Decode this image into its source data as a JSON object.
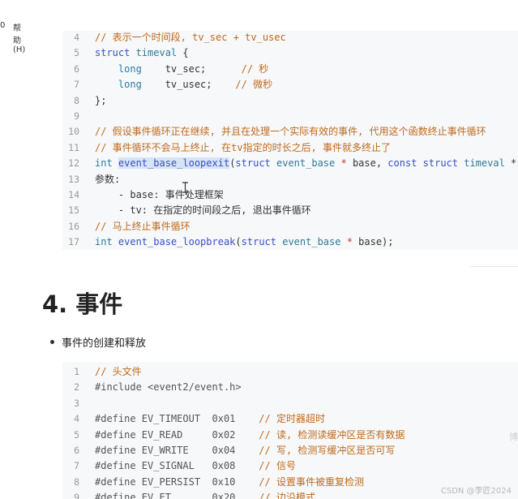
{
  "menu": {
    "left_fragment": "0",
    "help_label": "帮助(H)"
  },
  "code_block_1": {
    "lines": [
      {
        "n": "4",
        "parts": [
          {
            "t": "// 表示一个时间段, tv_sec + tv_usec",
            "c": "cm"
          }
        ]
      },
      {
        "n": "5",
        "parts": [
          {
            "t": "struct ",
            "c": "kw"
          },
          {
            "t": "timeval",
            "c": "ty"
          },
          {
            "t": " {",
            "c": "pl"
          }
        ]
      },
      {
        "n": "6",
        "parts": [
          {
            "t": "    long",
            "c": "ty"
          },
          {
            "t": "    tv_sec;      ",
            "c": "pl"
          },
          {
            "t": "// 秒",
            "c": "cm"
          }
        ]
      },
      {
        "n": "7",
        "parts": [
          {
            "t": "    long",
            "c": "ty"
          },
          {
            "t": "    tv_usec;    ",
            "c": "pl"
          },
          {
            "t": "// 微秒",
            "c": "cm"
          }
        ]
      },
      {
        "n": "8",
        "parts": [
          {
            "t": "};",
            "c": "pl"
          }
        ]
      },
      {
        "n": "9",
        "parts": []
      },
      {
        "n": "10",
        "parts": [
          {
            "t": "// 假设事件循环正在继续, 并且在处理一个实际有效的事件, 代用这个函数终止事件循环",
            "c": "cm"
          }
        ]
      },
      {
        "n": "11",
        "parts": [
          {
            "t": "// 事件循环不会马上终止, 在tv指定的时长之后, 事件就多终止了",
            "c": "cm"
          }
        ]
      },
      {
        "n": "12",
        "parts": [
          {
            "t": "int ",
            "c": "ty"
          },
          {
            "t": "event_base_loopexit",
            "c": "fn",
            "hl": true
          },
          {
            "t": "(",
            "c": "pl"
          },
          {
            "t": "struct ",
            "c": "kw"
          },
          {
            "t": "event_base",
            "c": "ty"
          },
          {
            "t": " * ",
            "c": "op"
          },
          {
            "t": "base, ",
            "c": "pl"
          },
          {
            "t": "const ",
            "c": "kw"
          },
          {
            "t": "struct ",
            "c": "kw"
          },
          {
            "t": "timeval",
            "c": "ty"
          },
          {
            "t": " * tv",
            "c": "pl"
          }
        ]
      },
      {
        "n": "13",
        "parts": [
          {
            "t": "参数:",
            "c": "pl"
          }
        ]
      },
      {
        "n": "14",
        "parts": [
          {
            "t": "    - base: 事件处理框架",
            "c": "pl"
          }
        ]
      },
      {
        "n": "15",
        "parts": [
          {
            "t": "    - tv: 在指定的时间段之后, 退出事件循环",
            "c": "pl"
          }
        ]
      },
      {
        "n": "16",
        "parts": [
          {
            "t": "// 马上终止事件循环",
            "c": "cm"
          }
        ]
      },
      {
        "n": "17",
        "parts": [
          {
            "t": "int ",
            "c": "ty"
          },
          {
            "t": "event_base_loopbreak",
            "c": "fn"
          },
          {
            "t": "(",
            "c": "pl"
          },
          {
            "t": "struct ",
            "c": "kw"
          },
          {
            "t": "event_base",
            "c": "ty"
          },
          {
            "t": " * ",
            "c": "op"
          },
          {
            "t": "base);",
            "c": "pl"
          }
        ]
      }
    ]
  },
  "section": {
    "heading": "4. 事件",
    "bullet": "事件的创建和释放"
  },
  "code_block_2": {
    "lines": [
      {
        "n": "1",
        "parts": [
          {
            "t": "// 头文件",
            "c": "cm"
          }
        ]
      },
      {
        "n": "2",
        "parts": [
          {
            "t": "#include <event2/event.h>",
            "c": "pp"
          }
        ]
      },
      {
        "n": "3",
        "parts": []
      },
      {
        "n": "4",
        "parts": [
          {
            "t": "#define EV_TIMEOUT  0x01    ",
            "c": "pp"
          },
          {
            "t": "// 定时器超时",
            "c": "cm"
          }
        ]
      },
      {
        "n": "5",
        "parts": [
          {
            "t": "#define EV_READ     0x02    ",
            "c": "pp"
          },
          {
            "t": "// 读, 检测读缓冲区是否有数据",
            "c": "cm"
          }
        ]
      },
      {
        "n": "6",
        "parts": [
          {
            "t": "#define EV_WRITE    0x04    ",
            "c": "pp"
          },
          {
            "t": "// 写, 检测写缓冲区是否可写",
            "c": "cm"
          }
        ]
      },
      {
        "n": "7",
        "parts": [
          {
            "t": "#define EV_SIGNAL   0x08    ",
            "c": "pp"
          },
          {
            "t": "// 信号",
            "c": "cm"
          }
        ]
      },
      {
        "n": "8",
        "parts": [
          {
            "t": "#define EV_PERSIST  0x10    ",
            "c": "pp"
          },
          {
            "t": "// 设置事件被重复检测",
            "c": "cm"
          }
        ]
      },
      {
        "n": "9",
        "parts": [
          {
            "t": "#define EV_ET       0x20    ",
            "c": "pp"
          },
          {
            "t": "// 边沿模式",
            "c": "cm"
          }
        ]
      }
    ]
  },
  "watermark": "CSDN @李匠2024",
  "side_glyph": "博",
  "colors": {
    "code_bg": "#f6f8fa",
    "comment": "#c06a1a",
    "keyword": "#3a4fc7",
    "type": "#2f7a9a",
    "highlight": "#d6e4f5"
  }
}
